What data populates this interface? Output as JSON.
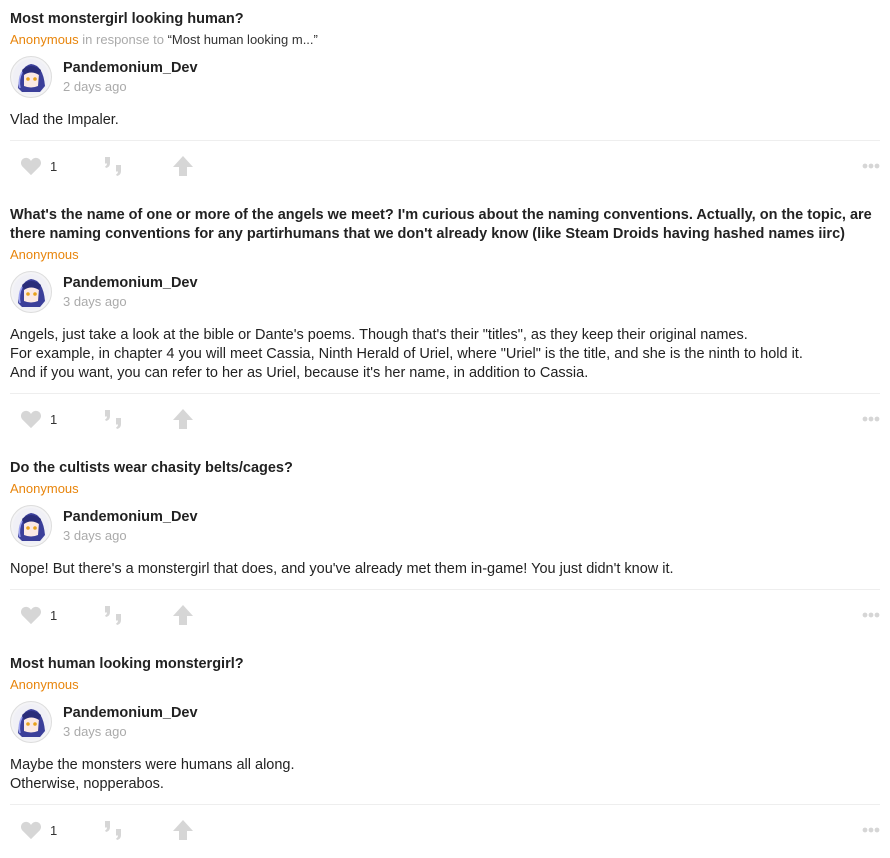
{
  "posts": [
    {
      "question": "Most monstergirl looking human?",
      "asker": "Anonymous",
      "in_response_to": "in response to",
      "quote": "“Most human looking m...”",
      "author": "Pandemonium_Dev",
      "timestamp": "2 days ago",
      "answer_lines": [
        "Vlad the Impaler."
      ],
      "likes": "1"
    },
    {
      "question": "What's the name of one or more of the angels we meet? I'm curious about the naming conventions. Actually, on the topic, are there naming conventions for any partirhumans that we don't already know (like Steam Droids having hashed names iirc)",
      "asker": "Anonymous",
      "author": "Pandemonium_Dev",
      "timestamp": "3 days ago",
      "answer_lines": [
        "Angels, just take a look at the bible or Dante's poems. Though that's their \"titles\", as they keep their original names.",
        "For example, in chapter 4 you will meet Cassia, Ninth Herald of Uriel, where \"Uriel\" is the title, and she is the ninth to hold it.",
        "And if you want, you can refer to her as Uriel, because it's her name, in addition to Cassia."
      ],
      "likes": "1"
    },
    {
      "question": "Do the cultists wear chasity belts/cages?",
      "asker": "Anonymous",
      "author": "Pandemonium_Dev",
      "timestamp": "3 days ago",
      "answer_lines": [
        "Nope! But there's a monstergirl that does, and you've already met them in-game! You just didn't know it."
      ],
      "likes": "1"
    },
    {
      "question": "Most human looking monstergirl?",
      "asker": "Anonymous",
      "author": "Pandemonium_Dev",
      "timestamp": "3 days ago",
      "answer_lines": [
        "Maybe the monsters were humans all along.",
        "Otherwise, nopperabos."
      ],
      "likes": "1"
    }
  ],
  "icons": {
    "like": "heart-icon",
    "quote": "quote-icon",
    "share": "share-arrow-icon",
    "more": "more-dots-icon"
  },
  "colors": {
    "accent": "#e8850c",
    "muted": "#aaaaaa",
    "icon": "#d6d6d6"
  }
}
